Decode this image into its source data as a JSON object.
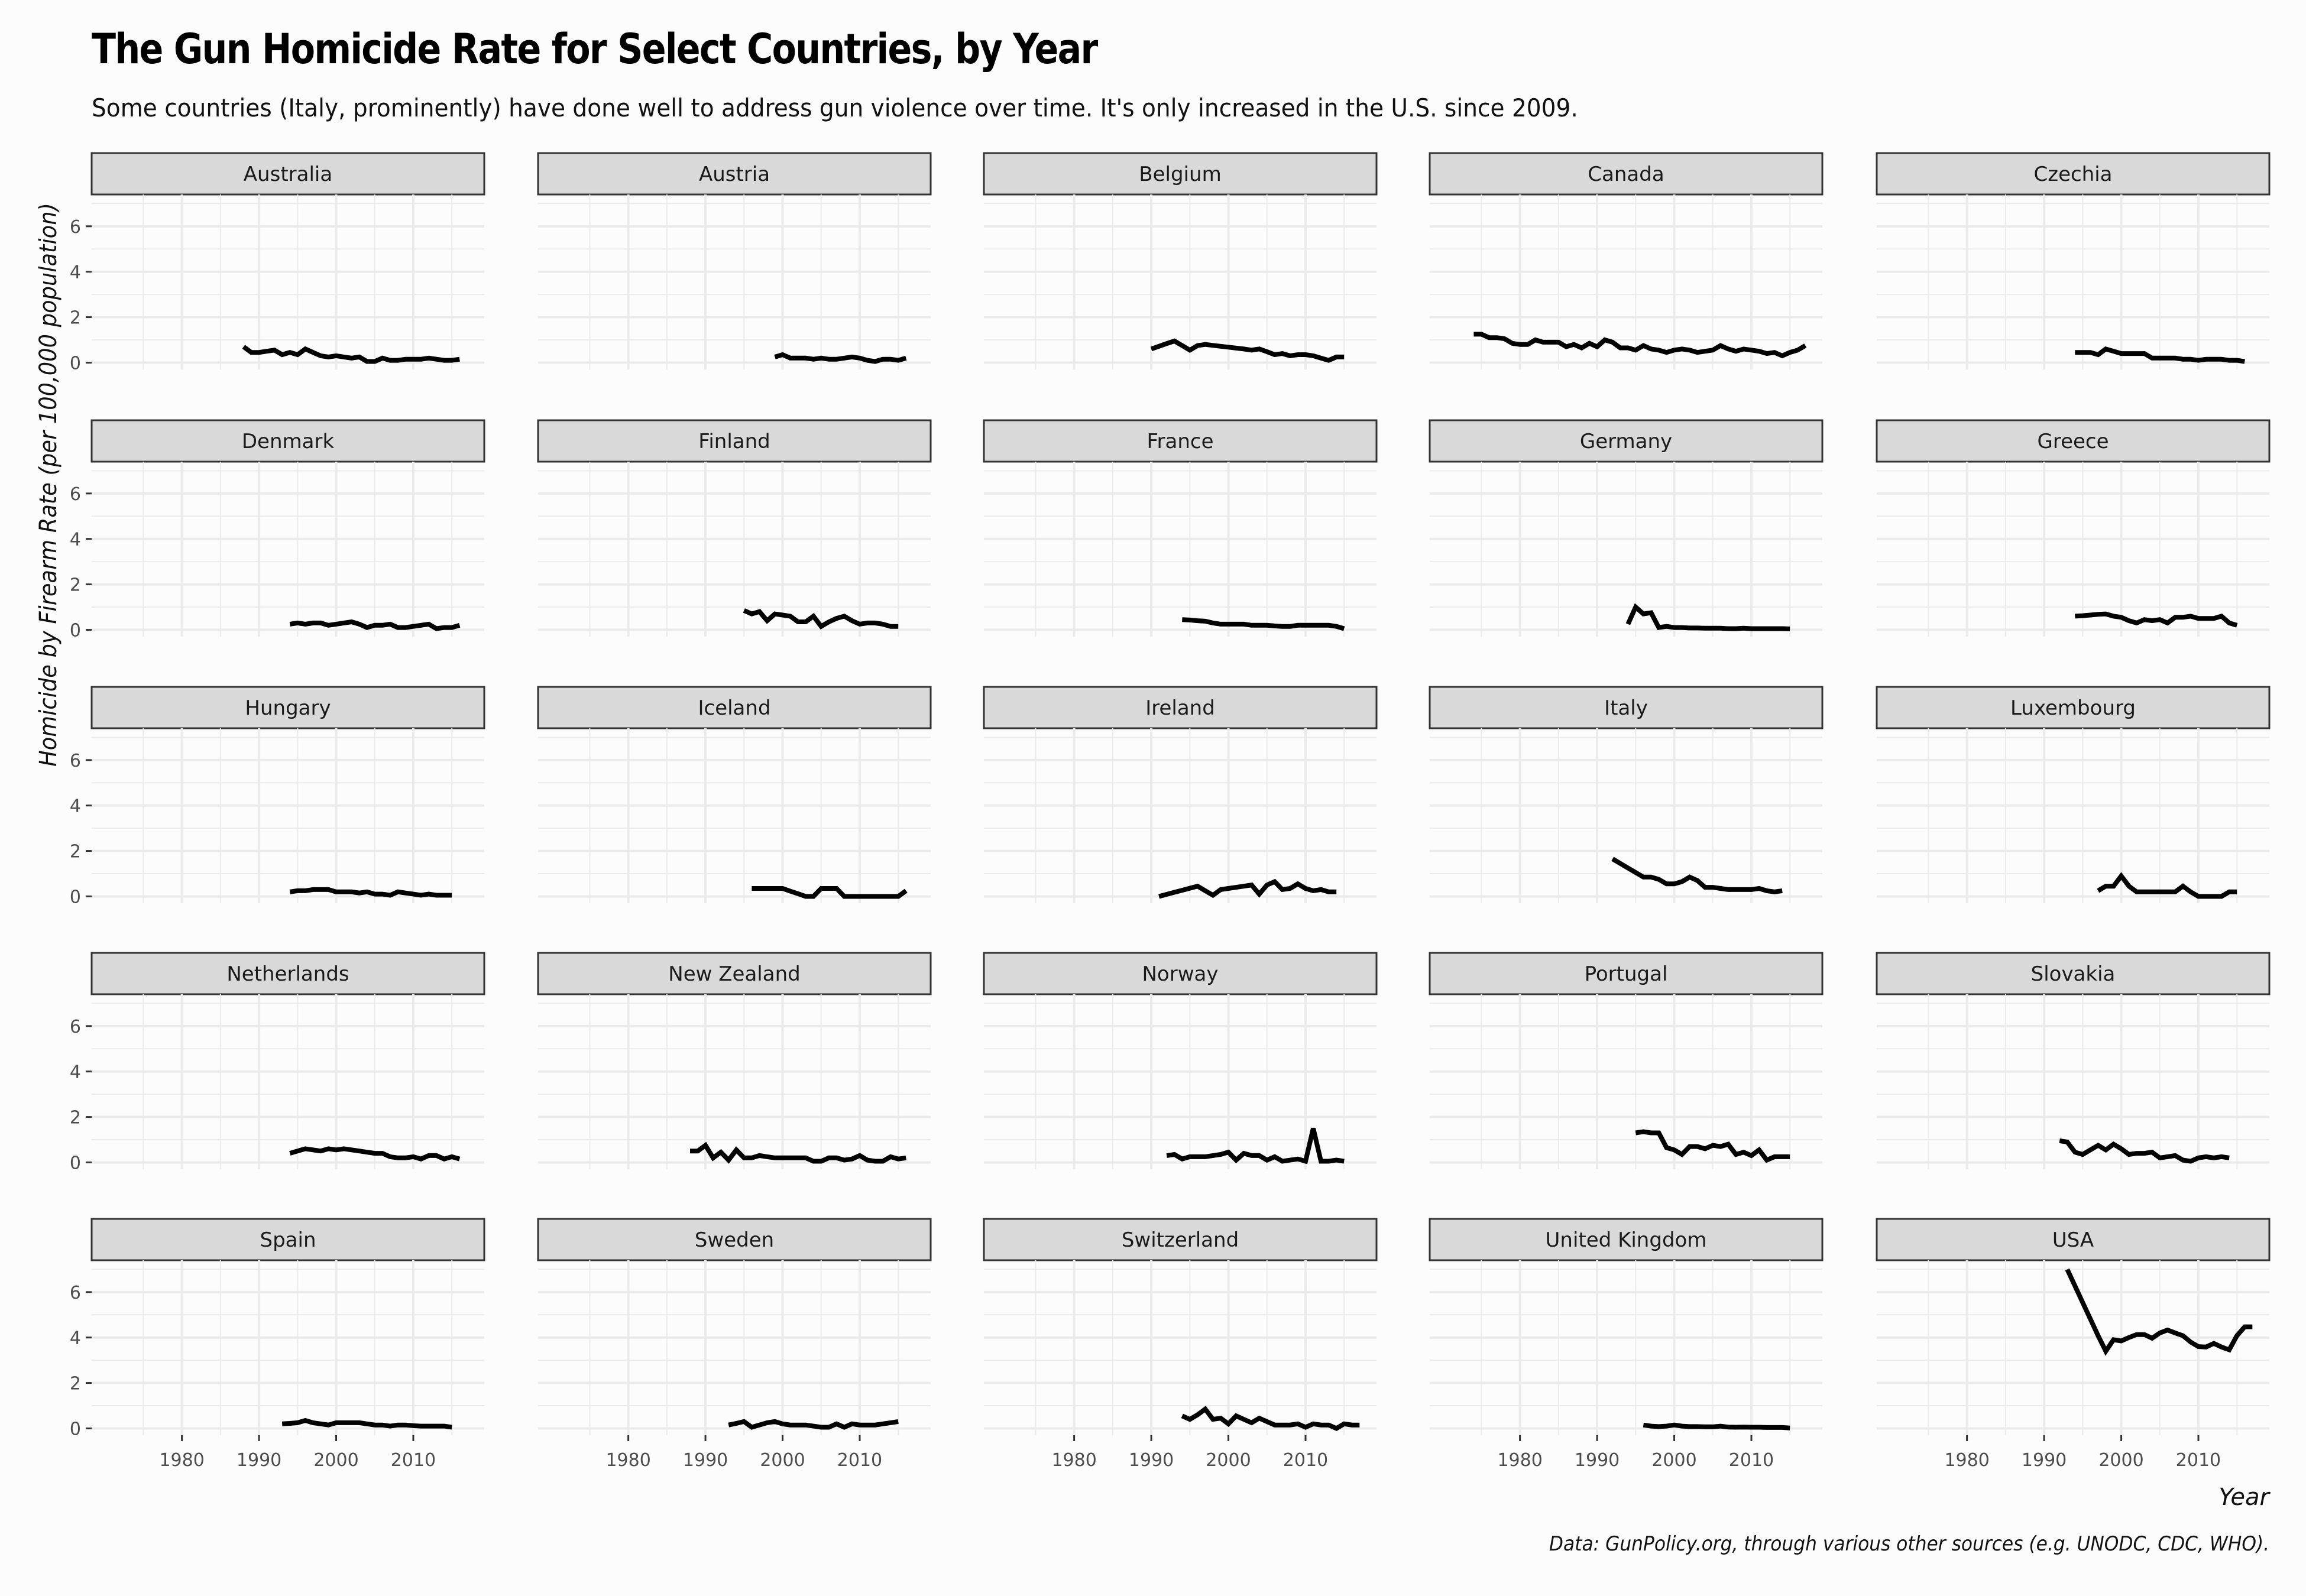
{
  "chart_data": {
    "type": "line",
    "title": "The Gun Homicide Rate for Select Countries, by Year",
    "subtitle": "Some countries (Italy, prominently) have done well to address gun violence over time. It's only increased in the U.S. since 2009.",
    "xlabel": "Year",
    "ylabel": "Homicide by Firearm Rate (per 100,000 population)",
    "caption": "Data: GunPolicy.org, through various other sources (e.g. UNODC, CDC, WHO).",
    "xlim": [
      1968.3,
      2019.2
    ],
    "ylim": [
      -0.3,
      7.4
    ],
    "x_ticks": [
      1980,
      1990,
      2000,
      2010
    ],
    "y_ticks": [
      0,
      2,
      4,
      6
    ],
    "grid": true,
    "facet_layout": "5x5",
    "panels": [
      {
        "name": "Australia",
        "start": 1988,
        "values": [
          0.7,
          0.45,
          0.45,
          0.5,
          0.55,
          0.35,
          0.45,
          0.35,
          0.6,
          0.45,
          0.3,
          0.25,
          0.3,
          0.25,
          0.2,
          0.25,
          0.05,
          0.05,
          0.2,
          0.1,
          0.1,
          0.15,
          0.15,
          0.15,
          0.2,
          0.15,
          0.1,
          0.1,
          0.15
        ]
      },
      {
        "name": "Austria",
        "start": 1999,
        "values": [
          0.25,
          0.35,
          0.2,
          0.2,
          0.2,
          0.15,
          0.2,
          0.15,
          0.15,
          0.2,
          0.25,
          0.2,
          0.1,
          0.05,
          0.15,
          0.15,
          0.1,
          0.2
        ]
      },
      {
        "name": "Belgium",
        "start": 1990,
        "values": [
          0.6,
          0.72,
          0.84,
          0.95,
          0.75,
          0.55,
          0.75,
          0.8,
          0.76,
          0.72,
          0.68,
          0.64,
          0.6,
          0.55,
          0.6,
          0.48,
          0.35,
          0.4,
          0.3,
          0.35,
          0.35,
          0.3,
          0.2,
          0.1,
          0.25,
          0.25
        ]
      },
      {
        "name": "Canada",
        "start": 1974,
        "values": [
          1.25,
          1.25,
          1.1,
          1.1,
          1.05,
          0.85,
          0.8,
          0.8,
          1.0,
          0.9,
          0.9,
          0.9,
          0.7,
          0.8,
          0.65,
          0.85,
          0.7,
          1.0,
          0.9,
          0.65,
          0.65,
          0.55,
          0.75,
          0.6,
          0.55,
          0.45,
          0.55,
          0.6,
          0.55,
          0.45,
          0.5,
          0.55,
          0.75,
          0.6,
          0.5,
          0.6,
          0.55,
          0.5,
          0.4,
          0.45,
          0.3,
          0.45,
          0.55,
          0.75
        ]
      },
      {
        "name": "Czechia",
        "start": 1994,
        "values": [
          0.45,
          0.45,
          0.45,
          0.35,
          0.6,
          0.5,
          0.4,
          0.4,
          0.4,
          0.4,
          0.2,
          0.2,
          0.2,
          0.2,
          0.15,
          0.15,
          0.1,
          0.15,
          0.15,
          0.15,
          0.1,
          0.1,
          0.05
        ]
      },
      {
        "name": "Denmark",
        "start": 1994,
        "values": [
          0.25,
          0.3,
          0.25,
          0.3,
          0.3,
          0.2,
          0.25,
          0.3,
          0.35,
          0.25,
          0.1,
          0.2,
          0.2,
          0.25,
          0.1,
          0.1,
          0.15,
          0.2,
          0.25,
          0.05,
          0.1,
          0.1,
          0.2
        ]
      },
      {
        "name": "Finland",
        "start": 1995,
        "values": [
          0.85,
          0.7,
          0.8,
          0.4,
          0.7,
          0.65,
          0.6,
          0.35,
          0.35,
          0.6,
          0.15,
          0.35,
          0.5,
          0.6,
          0.4,
          0.25,
          0.3,
          0.3,
          0.25,
          0.15,
          0.15
        ]
      },
      {
        "name": "France",
        "start": 1994,
        "values": [
          0.45,
          0.43,
          0.4,
          0.38,
          0.3,
          0.25,
          0.25,
          0.25,
          0.25,
          0.2,
          0.2,
          0.2,
          0.17,
          0.15,
          0.15,
          0.2,
          0.2,
          0.2,
          0.2,
          0.2,
          0.15,
          0.05
        ]
      },
      {
        "name": "Germany",
        "start": 1994,
        "values": [
          0.25,
          1.0,
          0.7,
          0.75,
          0.1,
          0.15,
          0.1,
          0.1,
          0.08,
          0.08,
          0.07,
          0.07,
          0.07,
          0.05,
          0.05,
          0.07,
          0.05,
          0.05,
          0.05,
          0.05,
          0.05,
          0.04
        ]
      },
      {
        "name": "Greece",
        "start": 1994,
        "values": [
          0.6,
          0.62,
          0.65,
          0.68,
          0.7,
          0.6,
          0.55,
          0.4,
          0.3,
          0.45,
          0.4,
          0.45,
          0.3,
          0.55,
          0.55,
          0.6,
          0.5,
          0.5,
          0.5,
          0.6,
          0.3,
          0.2
        ]
      },
      {
        "name": "Hungary",
        "start": 1994,
        "values": [
          0.2,
          0.25,
          0.25,
          0.3,
          0.3,
          0.3,
          0.2,
          0.2,
          0.2,
          0.15,
          0.2,
          0.1,
          0.1,
          0.05,
          0.2,
          0.15,
          0.1,
          0.05,
          0.1,
          0.05,
          0.05,
          0.05
        ]
      },
      {
        "name": "Iceland",
        "start": 1996,
        "values": [
          0.35,
          0.35,
          0.35,
          0.35,
          0.35,
          0.23,
          0.12,
          0.0,
          0.0,
          0.35,
          0.35,
          0.35,
          0.0,
          0.0,
          0.0,
          0.0,
          0.0,
          0.0,
          0.0,
          0.0,
          0.25
        ]
      },
      {
        "name": "Ireland",
        "start": 1991,
        "values": [
          0.0,
          0.09,
          0.18,
          0.27,
          0.36,
          0.45,
          0.25,
          0.05,
          0.3,
          0.35,
          0.4,
          0.45,
          0.5,
          0.1,
          0.5,
          0.65,
          0.3,
          0.35,
          0.55,
          0.35,
          0.25,
          0.3,
          0.2,
          0.2
        ]
      },
      {
        "name": "Italy",
        "start": 1992,
        "values": [
          1.65,
          1.45,
          1.25,
          1.05,
          0.85,
          0.85,
          0.75,
          0.55,
          0.55,
          0.65,
          0.85,
          0.7,
          0.4,
          0.4,
          0.35,
          0.3,
          0.3,
          0.3,
          0.3,
          0.35,
          0.25,
          0.2,
          0.25
        ]
      },
      {
        "name": "Luxembourg",
        "start": 1997,
        "values": [
          0.25,
          0.45,
          0.45,
          0.9,
          0.45,
          0.2,
          0.2,
          0.2,
          0.2,
          0.2,
          0.2,
          0.45,
          0.2,
          0.0,
          0.0,
          0.0,
          0.0,
          0.2,
          0.2
        ]
      },
      {
        "name": "Netherlands",
        "start": 1994,
        "values": [
          0.4,
          0.5,
          0.6,
          0.55,
          0.5,
          0.6,
          0.55,
          0.6,
          0.55,
          0.5,
          0.45,
          0.4,
          0.4,
          0.25,
          0.2,
          0.2,
          0.25,
          0.15,
          0.3,
          0.3,
          0.15,
          0.25,
          0.15
        ]
      },
      {
        "name": "New Zealand",
        "start": 1988,
        "values": [
          0.5,
          0.5,
          0.75,
          0.2,
          0.45,
          0.1,
          0.55,
          0.2,
          0.2,
          0.3,
          0.25,
          0.2,
          0.2,
          0.2,
          0.2,
          0.2,
          0.05,
          0.05,
          0.2,
          0.2,
          0.1,
          0.15,
          0.3,
          0.1,
          0.05,
          0.05,
          0.25,
          0.15,
          0.2
        ]
      },
      {
        "name": "Norway",
        "start": 1992,
        "values": [
          0.3,
          0.35,
          0.15,
          0.25,
          0.25,
          0.25,
          0.3,
          0.35,
          0.45,
          0.1,
          0.4,
          0.3,
          0.3,
          0.1,
          0.25,
          0.05,
          0.1,
          0.15,
          0.05,
          1.5,
          0.05,
          0.05,
          0.1,
          0.05
        ]
      },
      {
        "name": "Portugal",
        "start": 1995,
        "values": [
          1.3,
          1.35,
          1.3,
          1.3,
          0.65,
          0.55,
          0.35,
          0.7,
          0.7,
          0.6,
          0.75,
          0.7,
          0.8,
          0.35,
          0.45,
          0.3,
          0.55,
          0.1,
          0.25,
          0.25,
          0.25
        ]
      },
      {
        "name": "Slovakia",
        "start": 1992,
        "values": [
          0.95,
          0.9,
          0.45,
          0.35,
          0.55,
          0.75,
          0.55,
          0.8,
          0.6,
          0.35,
          0.4,
          0.4,
          0.45,
          0.2,
          0.25,
          0.3,
          0.1,
          0.05,
          0.2,
          0.25,
          0.2,
          0.25,
          0.2
        ]
      },
      {
        "name": "Spain",
        "start": 1993,
        "values": [
          0.2,
          0.22,
          0.25,
          0.35,
          0.25,
          0.2,
          0.15,
          0.25,
          0.25,
          0.25,
          0.25,
          0.2,
          0.15,
          0.15,
          0.1,
          0.15,
          0.15,
          0.12,
          0.1,
          0.1,
          0.1,
          0.1,
          0.05
        ]
      },
      {
        "name": "Sweden",
        "start": 1993,
        "values": [
          0.15,
          0.22,
          0.3,
          0.05,
          0.15,
          0.25,
          0.3,
          0.2,
          0.15,
          0.15,
          0.15,
          0.1,
          0.05,
          0.05,
          0.2,
          0.05,
          0.2,
          0.15,
          0.15,
          0.15,
          0.2,
          0.25,
          0.3
        ]
      },
      {
        "name": "Switzerland",
        "start": 1994,
        "values": [
          0.55,
          0.4,
          0.6,
          0.85,
          0.4,
          0.45,
          0.2,
          0.55,
          0.4,
          0.25,
          0.45,
          0.3,
          0.15,
          0.15,
          0.15,
          0.2,
          0.05,
          0.2,
          0.15,
          0.15,
          0.0,
          0.2,
          0.15,
          0.15
        ]
      },
      {
        "name": "United Kingdom",
        "start": 1996,
        "values": [
          0.15,
          0.1,
          0.08,
          0.1,
          0.15,
          0.1,
          0.08,
          0.08,
          0.07,
          0.07,
          0.1,
          0.06,
          0.05,
          0.06,
          0.05,
          0.05,
          0.04,
          0.04,
          0.04,
          0.02
        ]
      },
      {
        "name": "USA",
        "start": 1993,
        "values": [
          7.0,
          6.27,
          5.54,
          4.81,
          4.08,
          3.4,
          3.9,
          3.85,
          4.0,
          4.13,
          4.13,
          3.97,
          4.2,
          4.33,
          4.2,
          4.08,
          3.8,
          3.6,
          3.58,
          3.74,
          3.58,
          3.46,
          4.08,
          4.47,
          4.47
        ]
      }
    ]
  }
}
